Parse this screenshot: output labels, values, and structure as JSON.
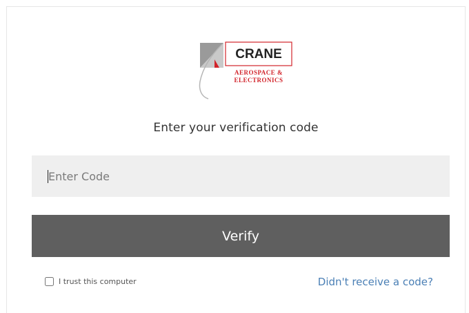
{
  "logo": {
    "brand": "CRANE",
    "line1": "AEROSPACE &",
    "line2": "ELECTRONICS",
    "accent_color": "#d2232a"
  },
  "heading": "Enter your verification code",
  "code_input": {
    "placeholder": "Enter Code",
    "value": ""
  },
  "verify_button": {
    "label": "Verify",
    "background": "#5f5f5f"
  },
  "trust_checkbox": {
    "label": "I trust this computer",
    "checked": false
  },
  "resend_link": {
    "label": "Didn't receive a code?",
    "color": "#4a7fb5"
  }
}
